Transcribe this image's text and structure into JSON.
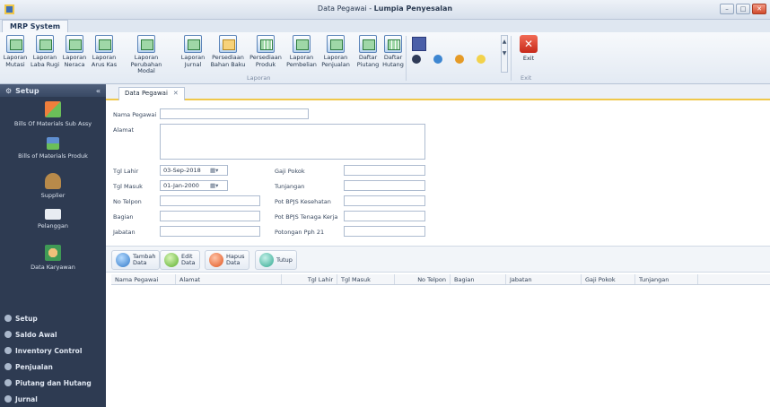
{
  "window": {
    "title_prefix": "Data Pegawai - ",
    "title_bold": "Lumpia Penyesalan",
    "min": "–",
    "max": "□",
    "close": "✕"
  },
  "ribbon_tab": "MRP System",
  "ribbon": {
    "buttons": [
      {
        "l1": "Laporan",
        "l2": "Mutasi"
      },
      {
        "l1": "Laporan",
        "l2": "Laba Rugi"
      },
      {
        "l1": "Laporan",
        "l2": "Neraca"
      },
      {
        "l1": "Laporan",
        "l2": "Arus Kas"
      },
      {
        "l1": "Laporan",
        "l2": "Perubahan Modal"
      },
      {
        "l1": "Laporan",
        "l2": "Jurnal"
      },
      {
        "l1": "Persediaan",
        "l2": "Bahan Baku"
      },
      {
        "l1": "Persediaan",
        "l2": "Produk"
      },
      {
        "l1": "Laporan",
        "l2": "Pembelian"
      },
      {
        "l1": "Laporan",
        "l2": "Penjualan"
      },
      {
        "l1": "Daftar",
        "l2": "Piutang"
      },
      {
        "l1": "Daftar",
        "l2": "Hutang"
      }
    ],
    "group_laporan": "Laporan",
    "exit_label": "Exit",
    "group_exit": "Exit",
    "scroll_up": "▲",
    "scroll_down": "▼"
  },
  "sidebar": {
    "header": "Setup",
    "chevron": "«",
    "items": [
      {
        "label": "Bills Of Materials Sub Assy"
      },
      {
        "label": "Bills of Materials Produk"
      },
      {
        "label": "Supplier"
      },
      {
        "label": "Pelanggan"
      },
      {
        "label": "Data Karyawan"
      }
    ],
    "groups": [
      {
        "label": "Setup"
      },
      {
        "label": "Saldo Awal"
      },
      {
        "label": "Inventory Control"
      },
      {
        "label": "Penjualan"
      },
      {
        "label": "Piutang dan Hutang"
      },
      {
        "label": "Jurnal"
      }
    ]
  },
  "doc_tab": {
    "label": "Data Pegawai",
    "close": "✕"
  },
  "form": {
    "nama_label": "Nama Pegawai",
    "alamat_label": "Alamat",
    "tgl_lahir_label": "Tgl Lahir",
    "tgl_lahir_value": "03-Sep-2018",
    "tgl_masuk_label": "Tgl Masuk",
    "tgl_masuk_value": "01-Jan-2000",
    "telpon_label": "No Telpon",
    "bagian_label": "Bagian",
    "jabatan_label": "Jabatan",
    "gaji_label": "Gaji Pokok",
    "tunjangan_label": "Tunjangan",
    "bpjs_kes_label": "Pot BPJS Kesehatan",
    "bpjs_tk_label": "Pot BPJS Tenaga Kerja",
    "pph_label": "Potongan Pph 21",
    "cal_glyph": "▦▾"
  },
  "toolbar": {
    "tambah": [
      "Tambah",
      "Data"
    ],
    "edit": [
      "Edit",
      "Data"
    ],
    "hapus": [
      "Hapus",
      "Data"
    ],
    "tutup": "Tutup"
  },
  "grid": {
    "columns": [
      "Nama Pegawai",
      "Alamat",
      "Tgl Lahir",
      "Tgl Masuk",
      "No Telpon",
      "Bagian",
      "Jabatan",
      "Gaji Pokok",
      "Tunjangan"
    ]
  }
}
